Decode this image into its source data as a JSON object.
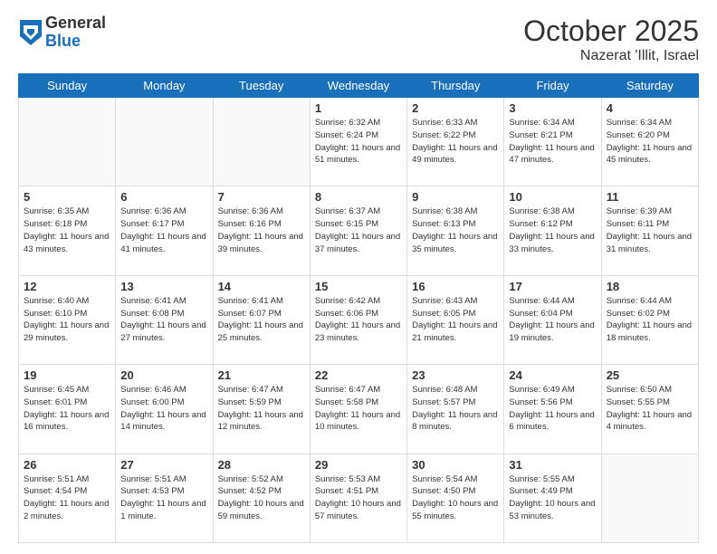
{
  "logo": {
    "general": "General",
    "blue": "Blue"
  },
  "title": {
    "month": "October 2025",
    "location": "Nazerat 'Illit, Israel"
  },
  "headers": [
    "Sunday",
    "Monday",
    "Tuesday",
    "Wednesday",
    "Thursday",
    "Friday",
    "Saturday"
  ],
  "weeks": [
    [
      {
        "day": "",
        "info": ""
      },
      {
        "day": "",
        "info": ""
      },
      {
        "day": "",
        "info": ""
      },
      {
        "day": "1",
        "info": "Sunrise: 6:32 AM\nSunset: 6:24 PM\nDaylight: 11 hours\nand 51 minutes."
      },
      {
        "day": "2",
        "info": "Sunrise: 6:33 AM\nSunset: 6:22 PM\nDaylight: 11 hours\nand 49 minutes."
      },
      {
        "day": "3",
        "info": "Sunrise: 6:34 AM\nSunset: 6:21 PM\nDaylight: 11 hours\nand 47 minutes."
      },
      {
        "day": "4",
        "info": "Sunrise: 6:34 AM\nSunset: 6:20 PM\nDaylight: 11 hours\nand 45 minutes."
      }
    ],
    [
      {
        "day": "5",
        "info": "Sunrise: 6:35 AM\nSunset: 6:18 PM\nDaylight: 11 hours\nand 43 minutes."
      },
      {
        "day": "6",
        "info": "Sunrise: 6:36 AM\nSunset: 6:17 PM\nDaylight: 11 hours\nand 41 minutes."
      },
      {
        "day": "7",
        "info": "Sunrise: 6:36 AM\nSunset: 6:16 PM\nDaylight: 11 hours\nand 39 minutes."
      },
      {
        "day": "8",
        "info": "Sunrise: 6:37 AM\nSunset: 6:15 PM\nDaylight: 11 hours\nand 37 minutes."
      },
      {
        "day": "9",
        "info": "Sunrise: 6:38 AM\nSunset: 6:13 PM\nDaylight: 11 hours\nand 35 minutes."
      },
      {
        "day": "10",
        "info": "Sunrise: 6:38 AM\nSunset: 6:12 PM\nDaylight: 11 hours\nand 33 minutes."
      },
      {
        "day": "11",
        "info": "Sunrise: 6:39 AM\nSunset: 6:11 PM\nDaylight: 11 hours\nand 31 minutes."
      }
    ],
    [
      {
        "day": "12",
        "info": "Sunrise: 6:40 AM\nSunset: 6:10 PM\nDaylight: 11 hours\nand 29 minutes."
      },
      {
        "day": "13",
        "info": "Sunrise: 6:41 AM\nSunset: 6:08 PM\nDaylight: 11 hours\nand 27 minutes."
      },
      {
        "day": "14",
        "info": "Sunrise: 6:41 AM\nSunset: 6:07 PM\nDaylight: 11 hours\nand 25 minutes."
      },
      {
        "day": "15",
        "info": "Sunrise: 6:42 AM\nSunset: 6:06 PM\nDaylight: 11 hours\nand 23 minutes."
      },
      {
        "day": "16",
        "info": "Sunrise: 6:43 AM\nSunset: 6:05 PM\nDaylight: 11 hours\nand 21 minutes."
      },
      {
        "day": "17",
        "info": "Sunrise: 6:44 AM\nSunset: 6:04 PM\nDaylight: 11 hours\nand 19 minutes."
      },
      {
        "day": "18",
        "info": "Sunrise: 6:44 AM\nSunset: 6:02 PM\nDaylight: 11 hours\nand 18 minutes."
      }
    ],
    [
      {
        "day": "19",
        "info": "Sunrise: 6:45 AM\nSunset: 6:01 PM\nDaylight: 11 hours\nand 16 minutes."
      },
      {
        "day": "20",
        "info": "Sunrise: 6:46 AM\nSunset: 6:00 PM\nDaylight: 11 hours\nand 14 minutes."
      },
      {
        "day": "21",
        "info": "Sunrise: 6:47 AM\nSunset: 5:59 PM\nDaylight: 11 hours\nand 12 minutes."
      },
      {
        "day": "22",
        "info": "Sunrise: 6:47 AM\nSunset: 5:58 PM\nDaylight: 11 hours\nand 10 minutes."
      },
      {
        "day": "23",
        "info": "Sunrise: 6:48 AM\nSunset: 5:57 PM\nDaylight: 11 hours\nand 8 minutes."
      },
      {
        "day": "24",
        "info": "Sunrise: 6:49 AM\nSunset: 5:56 PM\nDaylight: 11 hours\nand 6 minutes."
      },
      {
        "day": "25",
        "info": "Sunrise: 6:50 AM\nSunset: 5:55 PM\nDaylight: 11 hours\nand 4 minutes."
      }
    ],
    [
      {
        "day": "26",
        "info": "Sunrise: 5:51 AM\nSunset: 4:54 PM\nDaylight: 11 hours\nand 2 minutes."
      },
      {
        "day": "27",
        "info": "Sunrise: 5:51 AM\nSunset: 4:53 PM\nDaylight: 11 hours\nand 1 minute."
      },
      {
        "day": "28",
        "info": "Sunrise: 5:52 AM\nSunset: 4:52 PM\nDaylight: 10 hours\nand 59 minutes."
      },
      {
        "day": "29",
        "info": "Sunrise: 5:53 AM\nSunset: 4:51 PM\nDaylight: 10 hours\nand 57 minutes."
      },
      {
        "day": "30",
        "info": "Sunrise: 5:54 AM\nSunset: 4:50 PM\nDaylight: 10 hours\nand 55 minutes."
      },
      {
        "day": "31",
        "info": "Sunrise: 5:55 AM\nSunset: 4:49 PM\nDaylight: 10 hours\nand 53 minutes."
      },
      {
        "day": "",
        "info": ""
      }
    ]
  ]
}
